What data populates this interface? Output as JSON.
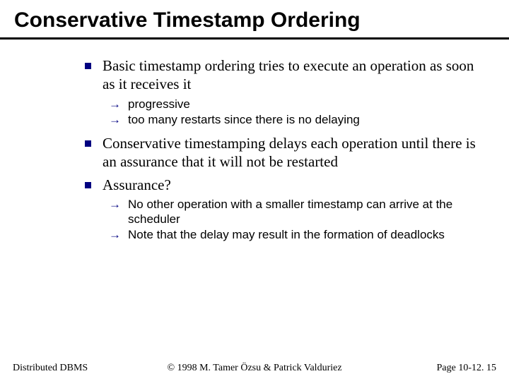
{
  "title": "Conservative Timestamp Ordering",
  "bullets": {
    "b1": "Basic timestamp ordering tries to execute an operation as soon as it receives it",
    "b1_sub": {
      "s1": "progressive",
      "s2": "too many restarts since there is no delaying"
    },
    "b2": "Conservative timestamping delays each operation until there is an assurance that it will not be restarted",
    "b3": "Assurance?",
    "b3_sub": {
      "s1": "No other operation with a smaller timestamp can arrive at the scheduler",
      "s2": "Note that the delay may result in the formation of deadlocks"
    }
  },
  "footer": {
    "left": "Distributed DBMS",
    "center": "© 1998 M. Tamer Özsu & Patrick Valduriez",
    "right": "Page 10-12. 15"
  },
  "colors": {
    "bullet": "#000080"
  }
}
